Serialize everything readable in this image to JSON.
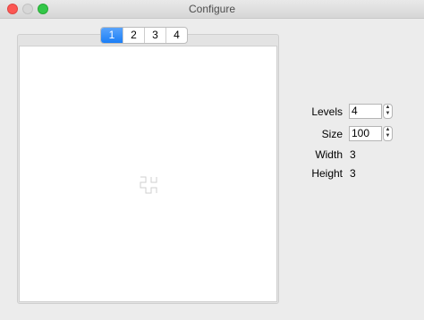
{
  "window": {
    "title": "Configure"
  },
  "tabs": [
    {
      "label": "1",
      "selected": true
    },
    {
      "label": "2",
      "selected": false
    },
    {
      "label": "3",
      "selected": false
    },
    {
      "label": "4",
      "selected": false
    }
  ],
  "settings": {
    "levels": {
      "label": "Levels",
      "value": "4"
    },
    "size": {
      "label": "Size",
      "value": "100"
    },
    "width": {
      "label": "Width",
      "value": "3"
    },
    "height": {
      "label": "Height",
      "value": "3"
    }
  },
  "colors": {
    "accent": "#1b7ef6",
    "close": "#fc5753",
    "zoom": "#33c748"
  }
}
